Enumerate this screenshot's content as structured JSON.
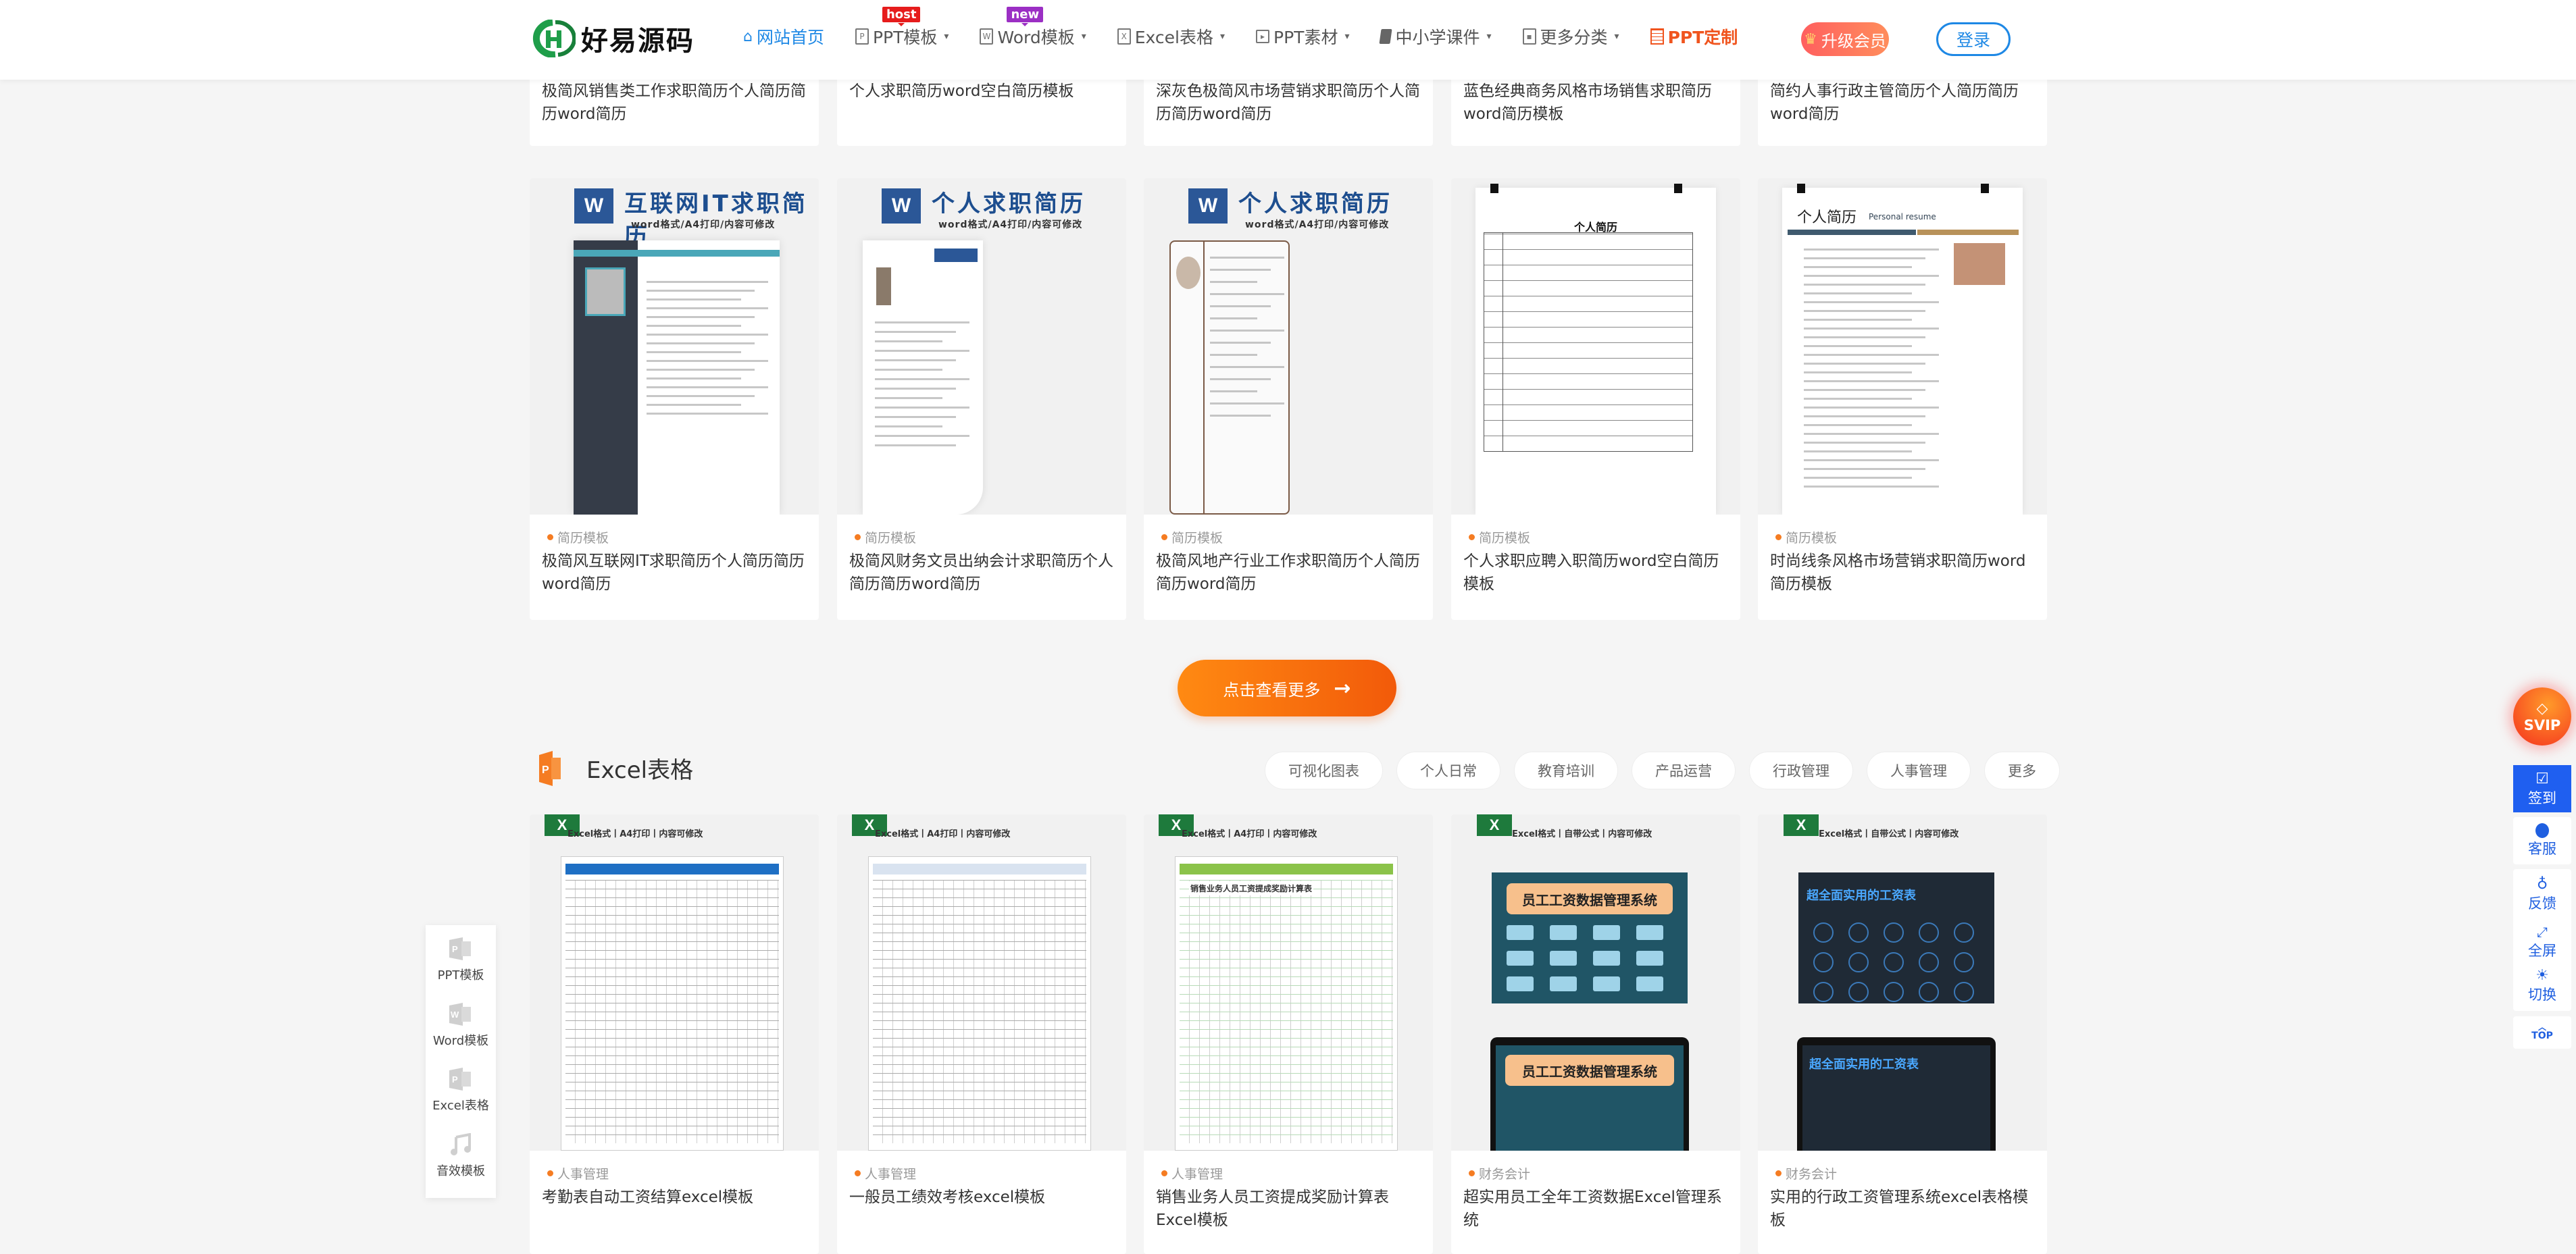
{
  "header": {
    "logo_text": "好易源码",
    "nav": [
      {
        "label": "网站首页",
        "icon": "home-icon",
        "active": true
      },
      {
        "label": "PPT模板",
        "icon": "ppt-file-icon",
        "badge": "host",
        "dropdown": true
      },
      {
        "label": "Word模板",
        "icon": "word-file-icon",
        "badge": "new",
        "dropdown": true
      },
      {
        "label": "Excel表格",
        "icon": "excel-file-icon",
        "dropdown": true
      },
      {
        "label": "PPT素材",
        "icon": "play-square-icon",
        "dropdown": true
      },
      {
        "label": "中小学课件",
        "icon": "book-icon",
        "dropdown": true
      },
      {
        "label": "更多分类",
        "icon": "video-file-icon",
        "dropdown": true
      },
      {
        "label": "PPT定制",
        "icon": "calendar-icon",
        "highlight": true
      }
    ],
    "vip_label": "升级会员",
    "login_label": "登录"
  },
  "top_cards": [
    {
      "title": "极简风销售类工作求职简历个人简历简历word简历"
    },
    {
      "title": "个人求职简历word空白简历模板"
    },
    {
      "title": "深灰色极简风市场营销求职简历个人简历简历word简历"
    },
    {
      "title": "蓝色经典商务风格市场销售求职简历word简历模板"
    },
    {
      "title": "简约人事行政主管简历个人简历简历word简历"
    }
  ],
  "resume_cards": [
    {
      "category": "简历模板",
      "title": "极简风互联网IT求职简历个人简历简历word简历",
      "thumb_heading": "互联网IT求职简历",
      "thumb_sub": "word格式/A4打印/内容可修改"
    },
    {
      "category": "简历模板",
      "title": "极简风财务文员出纳会计求职简历个人简历简历word简历",
      "thumb_heading": "个人求职简历",
      "thumb_sub": "word格式/A4打印/内容可修改"
    },
    {
      "category": "简历模板",
      "title": "极简风地产行业工作求职简历个人简历简历word简历",
      "thumb_heading": "个人求职简历",
      "thumb_sub": "word格式/A4打印/内容可修改"
    },
    {
      "category": "简历模板",
      "title": "个人求职应聘入职简历word空白简历模板",
      "thumb_heading": "个人简历",
      "thumb_sub": ""
    },
    {
      "category": "简历模板",
      "title": "时尚线条风格市场营销求职简历word简历模板",
      "thumb_heading": "个人简历",
      "thumb_sub": "Personal resume"
    }
  ],
  "more_button": {
    "label": "点击查看更多",
    "icon": "arrow-right-icon"
  },
  "excel_section": {
    "title": "Excel表格",
    "tags": [
      "可视化图表",
      "个人日常",
      "教育培训",
      "产品运营",
      "行政管理",
      "人事管理",
      "更多"
    ],
    "cards": [
      {
        "category": "人事管理",
        "title": "考勤表自动工资结算excel模板",
        "thumb_sub": "Excel格式丨A4打印丨内容可修改"
      },
      {
        "category": "人事管理",
        "title": "一般员工绩效考核excel模板",
        "thumb_sub": "Excel格式丨A4打印丨内容可修改"
      },
      {
        "category": "人事管理",
        "title": "销售业务人员工资提成奖励计算表Excel模板",
        "thumb_sub": "Excel格式丨A4打印丨内容可修改",
        "thumb_heading": "销售业务人员工资提成奖励计算表"
      },
      {
        "category": "财务会计",
        "title": "超实用员工全年工资数据Excel管理系统",
        "thumb_sub": "Excel格式丨自带公式丨内容可修改",
        "thumb_heading": "员工工资数据管理系统"
      },
      {
        "category": "财务会计",
        "title": "实用的行政工资管理系统excel表格模板",
        "thumb_sub": "Excel格式丨自带公式丨内容可修改",
        "thumb_heading": "超全面实用的工资表"
      }
    ]
  },
  "left_float": [
    {
      "label": "PPT模板",
      "icon": "ppt-icon"
    },
    {
      "label": "Word模板",
      "icon": "word-icon"
    },
    {
      "label": "Excel表格",
      "icon": "ppt-icon"
    },
    {
      "label": "音效模板",
      "icon": "music-note-icon"
    }
  ],
  "right_float": {
    "svip": "SVIP",
    "signin": "签到",
    "service": "客服",
    "feedback": "反馈",
    "fullscreen": "全屏",
    "switch": "切换",
    "top": "TOP"
  },
  "colors": {
    "accent": "#1e88e5",
    "orange": "#f57c22",
    "custom": "#f0541e",
    "signin": "#1f5ff0"
  }
}
